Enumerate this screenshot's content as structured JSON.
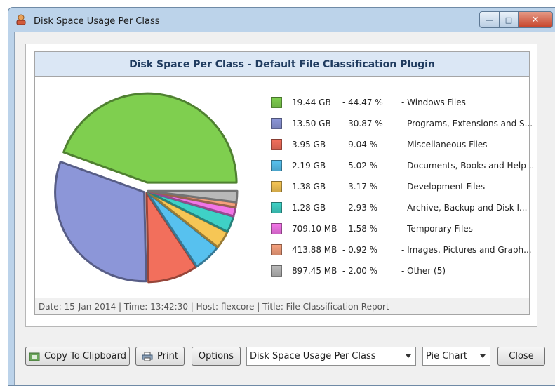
{
  "window": {
    "title": "Disk Space Usage Per Class",
    "minimize_glyph": "—",
    "maximize_glyph": "□",
    "close_glyph": "✕"
  },
  "chart": {
    "title": "Disk Space Per Class - Default File Classification Plugin",
    "footer": "Date: 15-Jan-2014 | Time: 13:42:30 | Host: flexcore | Title: File Classification Report"
  },
  "chart_data": {
    "type": "pie",
    "title": "Disk Space Per Class - Default File Classification Plugin",
    "legend": "right",
    "series": [
      {
        "size": "19.44 GB",
        "pct_label": "- 44.47 %",
        "desc": "- Windows Files",
        "value": 44.47,
        "color": "#7fcf4f"
      },
      {
        "size": "13.50 GB",
        "pct_label": "- 30.87 %",
        "desc": "- Programs, Extensions and S...",
        "value": 30.87,
        "color": "#8c96d8"
      },
      {
        "size": "3.95 GB",
        "pct_label": "- 9.04 %",
        "desc": "- Miscellaneous Files",
        "value": 9.04,
        "color": "#f26f5c"
      },
      {
        "size": "2.19 GB",
        "pct_label": "- 5.02 %",
        "desc": "- Documents, Books and Help ...",
        "value": 5.02,
        "color": "#57c1ef"
      },
      {
        "size": "1.38 GB",
        "pct_label": "- 3.17 %",
        "desc": "- Development Files",
        "value": 3.17,
        "color": "#f6c655"
      },
      {
        "size": "1.28 GB",
        "pct_label": "- 2.93 %",
        "desc": "- Archive, Backup and Disk I...",
        "value": 2.93,
        "color": "#3fd1c6"
      },
      {
        "size": "709.10 MB",
        "pct_label": "- 1.58 %",
        "desc": "- Temporary Files",
        "value": 1.58,
        "color": "#f275e7"
      },
      {
        "size": "413.88 MB",
        "pct_label": "- 0.92 %",
        "desc": "- Images, Pictures and Graph...",
        "value": 0.92,
        "color": "#f5a07d"
      },
      {
        "size": "897.45 MB",
        "pct_label": "- 2.00 %",
        "desc": "- Other (5)",
        "value": 2.0,
        "color": "#b9b9b9"
      }
    ],
    "exploded_slice": "- Windows Files"
  },
  "buttons": {
    "copy": "Copy To Clipboard",
    "print": "Print",
    "options": "Options",
    "report_select": "Disk Space Usage Per Class",
    "chart_select": "Pie Chart",
    "close": "Close"
  },
  "icons": {
    "app": "disk-person-icon",
    "copy": "clipboard-icon",
    "print": "printer-icon"
  }
}
